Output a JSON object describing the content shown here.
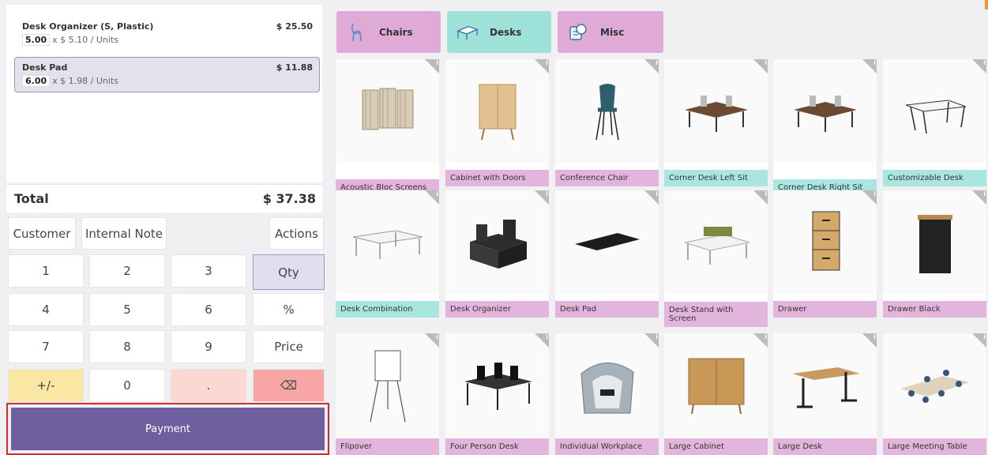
{
  "order": {
    "lines": [
      {
        "name": "Desk Organizer (S, Plastic)",
        "price": "$ 25.50",
        "qty": "5.00",
        "unit_info": "x $ 5.10 / Units",
        "selected": false
      },
      {
        "name": "Desk Pad",
        "price": "$ 11.88",
        "qty": "6.00",
        "unit_info": "x $ 1.98 / Units",
        "selected": true
      }
    ],
    "total_label": "Total",
    "total_value": "$ 37.38"
  },
  "controls": {
    "customer": "Customer",
    "internal_note": "Internal Note",
    "actions": "Actions"
  },
  "numpad": {
    "k1": "1",
    "k2": "2",
    "k3": "3",
    "qty": "Qty",
    "k4": "4",
    "k5": "5",
    "k6": "6",
    "percent": "%",
    "k7": "7",
    "k8": "8",
    "k9": "9",
    "price": "Price",
    "plusminus": "+/-",
    "k0": "0",
    "dot": ".",
    "backspace": "⌫"
  },
  "payment_label": "Payment",
  "categories": [
    {
      "label": "Chairs",
      "icon": "chair-icon",
      "color": "#dfaad6"
    },
    {
      "label": "Desks",
      "icon": "desk-icon",
      "color": "#9de1d9"
    },
    {
      "label": "Misc",
      "icon": "misc-icon",
      "color": "#dfaad6"
    }
  ],
  "products": [
    {
      "label": "Acoustic Bloc Screens",
      "color": "pink",
      "icon": "screen-panels-icon"
    },
    {
      "label": "Cabinet with Doors",
      "color": "pink",
      "icon": "cabinet-icon"
    },
    {
      "label": "Conference Chair",
      "color": "pink",
      "icon": "chair-icon"
    },
    {
      "label": "Corner Desk Left Sit",
      "color": "teal",
      "icon": "desk-icon"
    },
    {
      "label": "Corner Desk Right Sit",
      "color": "teal",
      "icon": "desk-icon"
    },
    {
      "label": "Customizable Desk",
      "color": "teal",
      "icon": "table-icon"
    },
    {
      "label": "Desk Combination",
      "color": "teal",
      "icon": "desk-combination-icon"
    },
    {
      "label": "Desk Organizer",
      "color": "pink",
      "icon": "organizer-icon"
    },
    {
      "label": "Desk Pad",
      "color": "pink",
      "icon": "desk-pad-icon"
    },
    {
      "label": "Desk Stand with Screen",
      "color": "pink",
      "icon": "desk-stand-icon"
    },
    {
      "label": "Drawer",
      "color": "pink",
      "icon": "drawer-icon"
    },
    {
      "label": "Drawer Black",
      "color": "pink",
      "icon": "drawer-black-icon"
    },
    {
      "label": "Flipover",
      "color": "pink",
      "icon": "flipchart-icon"
    },
    {
      "label": "Four Person Desk",
      "color": "pink",
      "icon": "four-desk-icon"
    },
    {
      "label": "Individual Workplace",
      "color": "pink",
      "icon": "workplace-pod-icon"
    },
    {
      "label": "Large Cabinet",
      "color": "pink",
      "icon": "large-cabinet-icon"
    },
    {
      "label": "Large Desk",
      "color": "pink",
      "icon": "large-desk-icon"
    },
    {
      "label": "Large Meeting Table",
      "color": "pink",
      "icon": "meeting-table-icon"
    }
  ]
}
